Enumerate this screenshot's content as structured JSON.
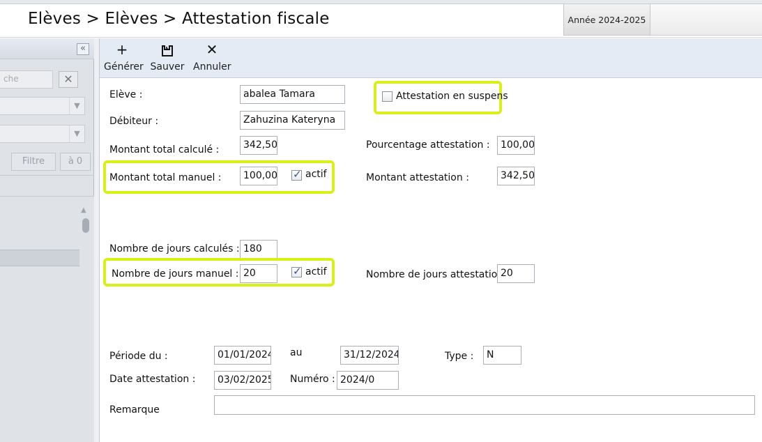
{
  "header": {
    "breadcrumb": "Elèves > Elèves > Attestation fiscale",
    "year_tab": "Année 2024-2025"
  },
  "left_panel": {
    "collapse_label": "«",
    "search_placeholder": "che",
    "clear_label": "✕",
    "filter_button": "Filtre",
    "reset_button": "à 0"
  },
  "toolbar": {
    "generate": {
      "icon": "plus-icon",
      "label": "Générer"
    },
    "save": {
      "icon": "save-icon",
      "label": "Sauver"
    },
    "cancel": {
      "icon": "close-icon",
      "label": "Annuler"
    }
  },
  "form": {
    "eleve": {
      "label": "Elève :",
      "value": "abalea Tamara"
    },
    "debiteur": {
      "label": "Débiteur :",
      "value": "Zahuzina Kateryna"
    },
    "suspens": {
      "label": "Attestation en suspens",
      "checked": false
    },
    "montant_calcule": {
      "label": "Montant total calculé :",
      "value": "342,50"
    },
    "pourcentage": {
      "label": "Pourcentage attestation :",
      "value": "100,00"
    },
    "montant_manuel": {
      "label": "Montant total manuel :",
      "value": "100,00",
      "actif_label": "actif",
      "actif": true
    },
    "montant_attestation": {
      "label": "Montant attestation :",
      "value": "342,50"
    },
    "jours_calcules": {
      "label": "Nombre de jours calculés :",
      "value": "180"
    },
    "jours_manuel": {
      "label": "Nombre de jours manuel :",
      "value": "20",
      "actif_label": "actif",
      "actif": true
    },
    "jours_attestation": {
      "label": "Nombre de jours attestation:",
      "value": "20"
    },
    "periode": {
      "label": "Période du :",
      "from": "01/01/2024",
      "au_label": "au",
      "to": "31/12/2024"
    },
    "type": {
      "label": "Type :",
      "value": "N"
    },
    "date_attestation": {
      "label": "Date attestation :",
      "value": "03/02/2025"
    },
    "numero": {
      "label": "Numéro :",
      "value": "2024/0"
    },
    "remarque": {
      "label": "Remarque",
      "value": ""
    }
  },
  "highlight_color": "#d9ef18"
}
